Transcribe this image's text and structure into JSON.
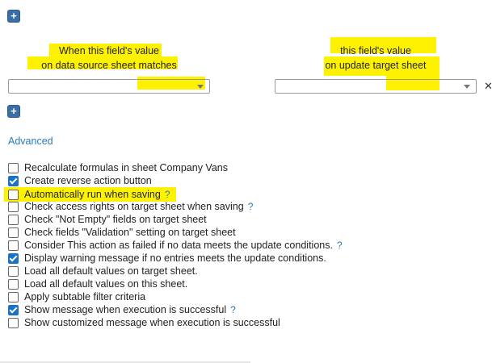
{
  "add_icon_glyph": "+",
  "left_header": {
    "line1": "When this field's value",
    "line2": "on data source sheet matches"
  },
  "right_header": {
    "line1": "this field's value",
    "line2": "on update target sheet"
  },
  "left_select": {
    "value": ""
  },
  "right_select": {
    "value": ""
  },
  "remove_glyph": "✕",
  "advanced_link": "Advanced",
  "help_glyph": "?",
  "options": [
    {
      "label": "Recalculate formulas in sheet Company Vans",
      "checked": false,
      "help": false
    },
    {
      "label": "Create reverse action button",
      "checked": true,
      "help": false
    },
    {
      "label": "Automatically run when saving",
      "checked": false,
      "help": true
    },
    {
      "label": "Check access rights on target sheet when saving",
      "checked": false,
      "help": true
    },
    {
      "label": "Check \"Not Empty\" fields on target sheet",
      "checked": false,
      "help": false
    },
    {
      "label": "Check fields \"Validation\" setting on target sheet",
      "checked": false,
      "help": false
    },
    {
      "label": "Consider This action as failed if no data meets the update conditions.",
      "checked": false,
      "help": true
    },
    {
      "label": "Display warning message if no entries meets the update conditions.",
      "checked": true,
      "help": false
    },
    {
      "label": "Load all default values on target sheet.",
      "checked": false,
      "help": false
    },
    {
      "label": "Load all default values on this sheet.",
      "checked": false,
      "help": false
    },
    {
      "label": "Apply subtable filter criteria",
      "checked": false,
      "help": false
    },
    {
      "label": "Show message when execution is successful",
      "checked": true,
      "help": true
    },
    {
      "label": "Show customized message when execution is successful",
      "checked": false,
      "help": false
    }
  ],
  "colors": {
    "highlight": "#fff200",
    "accent": "#2a7ab8",
    "checkbox_checked": "#1a72c7",
    "add_button": "#3a6ea5"
  }
}
